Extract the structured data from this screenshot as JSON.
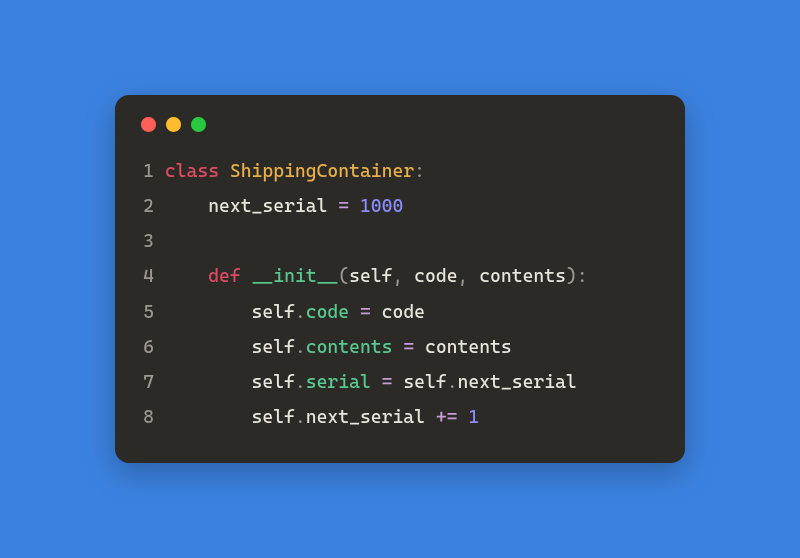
{
  "window": {
    "buttons": [
      "close",
      "minimize",
      "zoom"
    ]
  },
  "code": {
    "lines": [
      {
        "n": "1",
        "tokens": [
          {
            "t": "class",
            "c": "kw"
          },
          {
            "t": " ",
            "c": "plain"
          },
          {
            "t": "ShippingContainer",
            "c": "cls"
          },
          {
            "t": ":",
            "c": "punct"
          }
        ]
      },
      {
        "n": "2",
        "tokens": [
          {
            "t": "    next_serial ",
            "c": "plain"
          },
          {
            "t": "=",
            "c": "op"
          },
          {
            "t": " ",
            "c": "plain"
          },
          {
            "t": "1000",
            "c": "num"
          }
        ]
      },
      {
        "n": "3",
        "tokens": [
          {
            "t": "",
            "c": "plain"
          }
        ]
      },
      {
        "n": "4",
        "tokens": [
          {
            "t": "    ",
            "c": "plain"
          },
          {
            "t": "def",
            "c": "kw"
          },
          {
            "t": " ",
            "c": "plain"
          },
          {
            "t": "__init__",
            "c": "fn"
          },
          {
            "t": "(",
            "c": "punct"
          },
          {
            "t": "self",
            "c": "self"
          },
          {
            "t": ",",
            "c": "punct"
          },
          {
            "t": " code",
            "c": "plain"
          },
          {
            "t": ",",
            "c": "punct"
          },
          {
            "t": " contents",
            "c": "plain"
          },
          {
            "t": ")",
            "c": "punct"
          },
          {
            "t": ":",
            "c": "punct"
          }
        ]
      },
      {
        "n": "5",
        "tokens": [
          {
            "t": "        self",
            "c": "self"
          },
          {
            "t": ".",
            "c": "punct"
          },
          {
            "t": "code",
            "c": "fn"
          },
          {
            "t": " ",
            "c": "plain"
          },
          {
            "t": "=",
            "c": "op"
          },
          {
            "t": " code",
            "c": "plain"
          }
        ]
      },
      {
        "n": "6",
        "tokens": [
          {
            "t": "        self",
            "c": "self"
          },
          {
            "t": ".",
            "c": "punct"
          },
          {
            "t": "contents",
            "c": "fn"
          },
          {
            "t": " ",
            "c": "plain"
          },
          {
            "t": "=",
            "c": "op"
          },
          {
            "t": " contents",
            "c": "plain"
          }
        ]
      },
      {
        "n": "7",
        "tokens": [
          {
            "t": "        self",
            "c": "self"
          },
          {
            "t": ".",
            "c": "punct"
          },
          {
            "t": "serial",
            "c": "fn"
          },
          {
            "t": " ",
            "c": "plain"
          },
          {
            "t": "=",
            "c": "op"
          },
          {
            "t": " self",
            "c": "self"
          },
          {
            "t": ".",
            "c": "punct"
          },
          {
            "t": "next_serial",
            "c": "plain"
          }
        ]
      },
      {
        "n": "8",
        "tokens": [
          {
            "t": "        self",
            "c": "self"
          },
          {
            "t": ".",
            "c": "punct"
          },
          {
            "t": "next_serial",
            "c": "plain"
          },
          {
            "t": " ",
            "c": "plain"
          },
          {
            "t": "+=",
            "c": "op"
          },
          {
            "t": " ",
            "c": "plain"
          },
          {
            "t": "1",
            "c": "num"
          }
        ]
      }
    ]
  }
}
